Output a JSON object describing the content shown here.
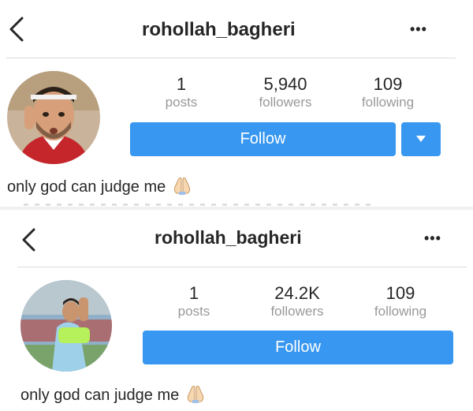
{
  "screens": [
    {
      "username": "rohollah_bagheri",
      "more_label": "•••",
      "posts": {
        "value": "1",
        "label": "posts"
      },
      "followers": {
        "value": "5,940",
        "label": "followers"
      },
      "following": {
        "value": "109",
        "label": "following"
      },
      "follow_label": "Follow",
      "bio": "only god can judge me"
    },
    {
      "username": "rohollah_bagheri",
      "more_label": "•••",
      "posts": {
        "value": "1",
        "label": "posts"
      },
      "followers": {
        "value": "24.2K",
        "label": "followers"
      },
      "following": {
        "value": "109",
        "label": "following"
      },
      "follow_label": "Follow",
      "bio": "only god can judge me"
    }
  ],
  "colors": {
    "accent": "#3897f0",
    "text": "#262626",
    "muted": "#999999",
    "divider": "#dbdbdb"
  },
  "icons": {
    "back": "chevron-left-icon",
    "more": "more-options-icon",
    "bio_emoji": "folded-hands-icon",
    "dropdown": "caret-down-icon"
  }
}
